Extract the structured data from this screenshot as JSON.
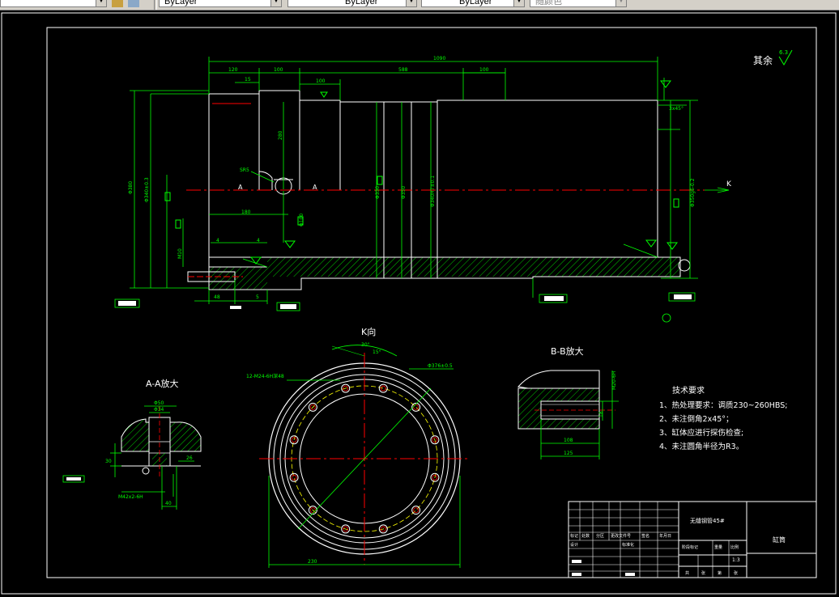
{
  "toolbar": {
    "layer_color": "ByLayer",
    "layer_linetype": "ByLayer",
    "layer_lineweight": "ByLayer",
    "plot_style": "随颜色"
  },
  "drawing": {
    "surface_finish_note": "其余",
    "finish_value": "6.3",
    "main_dims": {
      "overall_length": "1090",
      "d120": "120",
      "d100a": "100",
      "d100b": "100",
      "d15": "15",
      "d588": "588",
      "d100c": "100",
      "d280": "280",
      "r_s85": "SR5",
      "d180": "180",
      "d150": "Φ100",
      "section_mark_left": "A",
      "section_mark_right": "A",
      "view_mark_k": "K",
      "chamfer": "3x45°",
      "d4a": "4",
      "d4b": "4",
      "d48": "48",
      "d5": "5",
      "dia_left_1": "Φ380",
      "dia_left_2": "Φ340±0.3",
      "dia_mid_1": "Φ330",
      "dia_mid_2": "Φ350",
      "dia_mid_3": "Φ340H7±0.1",
      "dia_right": "Φ350g6-0.2",
      "thread_hole": "M10"
    },
    "view_k": {
      "title": "K向",
      "angle": "30°",
      "angle2": "15°",
      "holes_note": "12-M24-6H深48",
      "pcd_note": "Φ376±0.5",
      "bottom_dim": "230"
    },
    "detail_a": {
      "title": "A-A放大",
      "d_top1": "Φ50",
      "d_top2": "Φ34",
      "d_side1": "30",
      "d_side2": "26",
      "thread": "M42x2-6H",
      "d_bottom": "40"
    },
    "detail_b": {
      "title": "B-B放大",
      "d_vertical": "18",
      "d_horz1": "108",
      "d_horz2": "125",
      "d_side": "M20-6H"
    },
    "tech_requirements": {
      "title": "技术要求",
      "items": [
        "1、热处理要求：调质230~260HBS;",
        "2、未注倒角2x45°；",
        "3、缸体应进行探伤检查;",
        "4、未注圆角半径为R3。"
      ]
    },
    "title_block": {
      "material": "无缝钢管45#",
      "part_name": "缸筒",
      "scale": "1:3",
      "row_labels": [
        "标记",
        "处数",
        "分区",
        "更改文件号",
        "签名",
        "年月日"
      ],
      "design_row": [
        "设计",
        "",
        "",
        "标准化"
      ],
      "stage_labels": [
        "阶段标记",
        "重量",
        "比例"
      ],
      "sheet_labels": [
        "共",
        "张",
        "第",
        "张"
      ]
    }
  }
}
